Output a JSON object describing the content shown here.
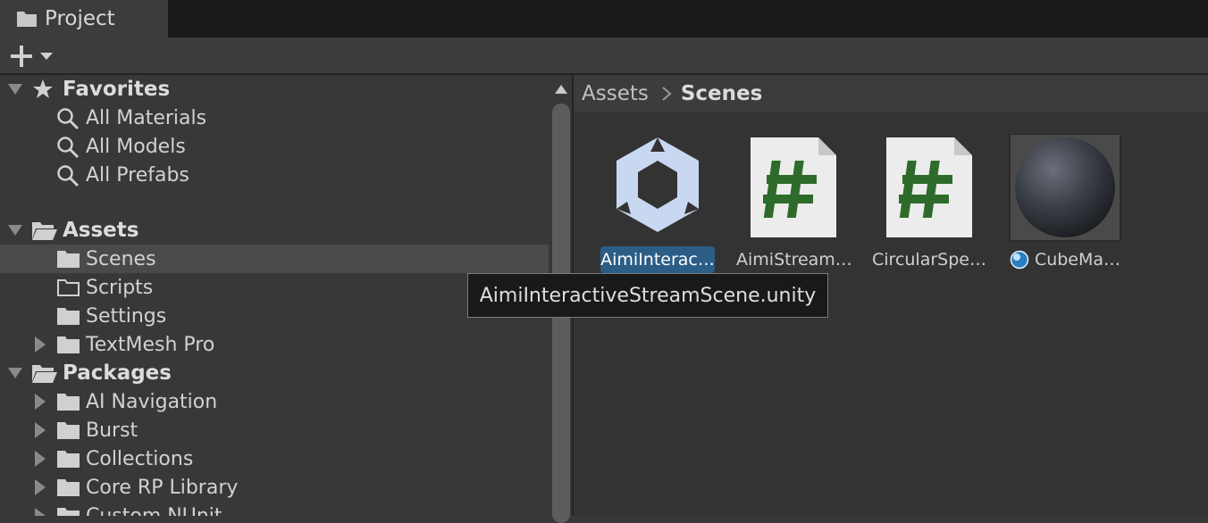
{
  "window": {
    "tab_label": "Project"
  },
  "tree": {
    "favorites": {
      "label": "Favorites",
      "items": [
        "All Materials",
        "All Models",
        "All Prefabs"
      ]
    },
    "assets": {
      "label": "Assets",
      "items": [
        "Scenes",
        "Scripts",
        "Settings",
        "TextMesh Pro"
      ]
    },
    "packages": {
      "label": "Packages",
      "items": [
        "AI Navigation",
        "Burst",
        "Collections",
        "Core RP Library",
        "Custom NUnit"
      ]
    }
  },
  "breadcrumb": {
    "root": "Assets",
    "current": "Scenes"
  },
  "assets": [
    {
      "name": "AimiInterac…",
      "type": "scene-icon"
    },
    {
      "name": "AimiStream…",
      "type": "csharp-script-icon"
    },
    {
      "name": "CircularSpe…",
      "type": "csharp-script-icon"
    },
    {
      "name": "CubeMa…",
      "type": "material-icon"
    }
  ],
  "tooltip": {
    "text": "AimiInteractiveStreamScene.unity"
  },
  "colors": {
    "selection": "#2c5d87",
    "script_hash": "#2e6b2a",
    "unity_logo": "#c8d8f0"
  }
}
